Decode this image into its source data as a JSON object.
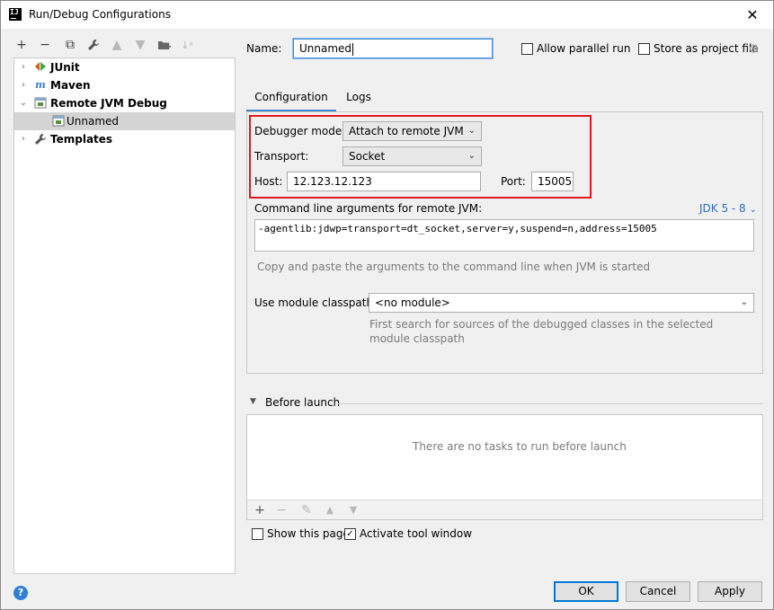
{
  "window": {
    "title": "Run/Debug Configurations",
    "app_icon_text": "IJ"
  },
  "tree": {
    "items": [
      {
        "label": "JUnit",
        "icon": "junit-icon",
        "arrow": "›"
      },
      {
        "label": "Maven",
        "icon": "maven-icon",
        "arrow": "›"
      },
      {
        "label": "Remote JVM Debug",
        "icon": "remote-debug-icon",
        "arrow": "⌄"
      },
      {
        "label": "Unnamed",
        "icon": "config-icon",
        "selected": true
      },
      {
        "label": "Templates",
        "icon": "wrench-icon",
        "arrow": "›"
      }
    ]
  },
  "header": {
    "name_label": "Name:",
    "name_value": "Unnamed",
    "allow_parallel_label": "Allow parallel run",
    "store_project_label": "Store as project file"
  },
  "tabs": [
    {
      "label": "Configuration",
      "active": true
    },
    {
      "label": "Logs",
      "active": false
    }
  ],
  "config": {
    "debugger_mode_label": "Debugger mode:",
    "debugger_mode_value": "Attach to remote JVM",
    "transport_label": "Transport:",
    "transport_value": "Socket",
    "host_label": "Host:",
    "host_value": "12.123.12.123",
    "port_label": "Port:",
    "port_value": "15005",
    "args_label": "Command line arguments for remote JVM:",
    "jdk_link": "JDK 5 - 8",
    "args_value": "-agentlib:jdwp=transport=dt_socket,server=y,suspend=n,address=15005",
    "args_hint": "Copy and paste the arguments to the command line when JVM is started",
    "module_label": "Use module classpath:",
    "module_value": "<no module>",
    "module_hint_1": "First search for sources of the debugged classes in the selected",
    "module_hint_2": "module classpath"
  },
  "before_launch": {
    "title": "Before launch",
    "empty_text": "There are no tasks to run before launch"
  },
  "options": {
    "show_page_label": "Show this page",
    "activate_tool_label": "Activate tool window"
  },
  "buttons": {
    "ok": "OK",
    "cancel": "Cancel",
    "apply": "Apply"
  },
  "colors": {
    "highlight": "#e0191f",
    "link": "#2f6fc4",
    "selection": "#d4d4d4",
    "accent": "#4083c9"
  }
}
